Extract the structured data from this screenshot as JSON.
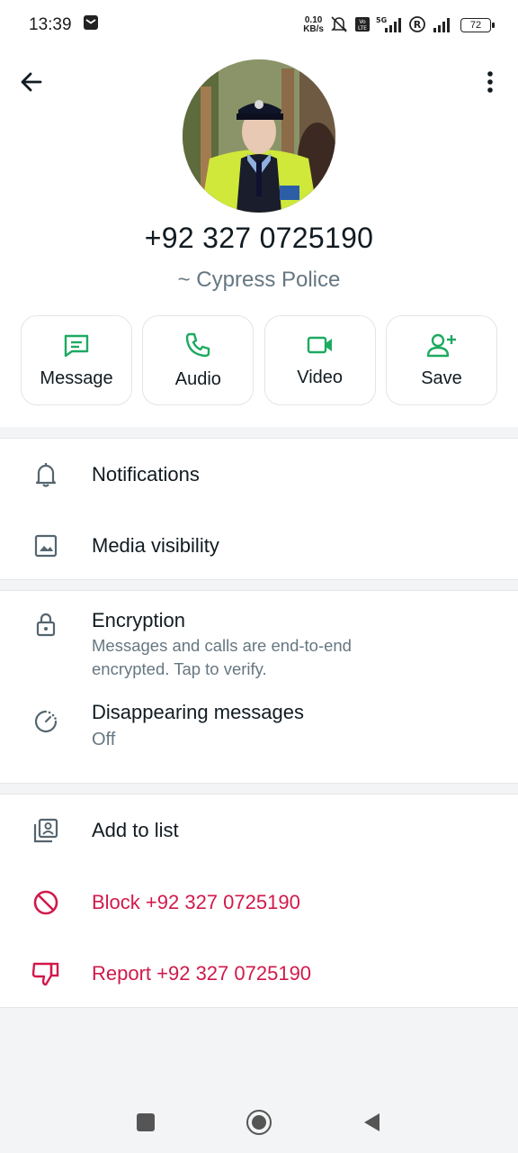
{
  "status_bar": {
    "time": "13:39",
    "net_speed_value": "0.10",
    "net_speed_unit": "KB/s",
    "battery": "72"
  },
  "contact": {
    "phone": "+92 327 0725190",
    "name": "~ Cypress Police"
  },
  "actions": [
    {
      "label": "Message",
      "icon": "message-icon"
    },
    {
      "label": "Audio",
      "icon": "phone-icon"
    },
    {
      "label": "Video",
      "icon": "video-icon"
    },
    {
      "label": "Save",
      "icon": "add-person-icon"
    }
  ],
  "settings": {
    "notifications": "Notifications",
    "media_visibility": "Media visibility"
  },
  "privacy": {
    "encryption_title": "Encryption",
    "encryption_sub_1": "Messages and calls are end-to-end",
    "encryption_sub_2": "encrypted. Tap to verify.",
    "disappearing_title": "Disappearing messages",
    "disappearing_sub": "Off"
  },
  "more": {
    "add_to_list": "Add to list",
    "block": "Block +92 327 0725190",
    "report": "Report +92 327 0725190"
  },
  "colors": {
    "accent_green": "#1daa61",
    "danger_red": "#d1194b"
  }
}
